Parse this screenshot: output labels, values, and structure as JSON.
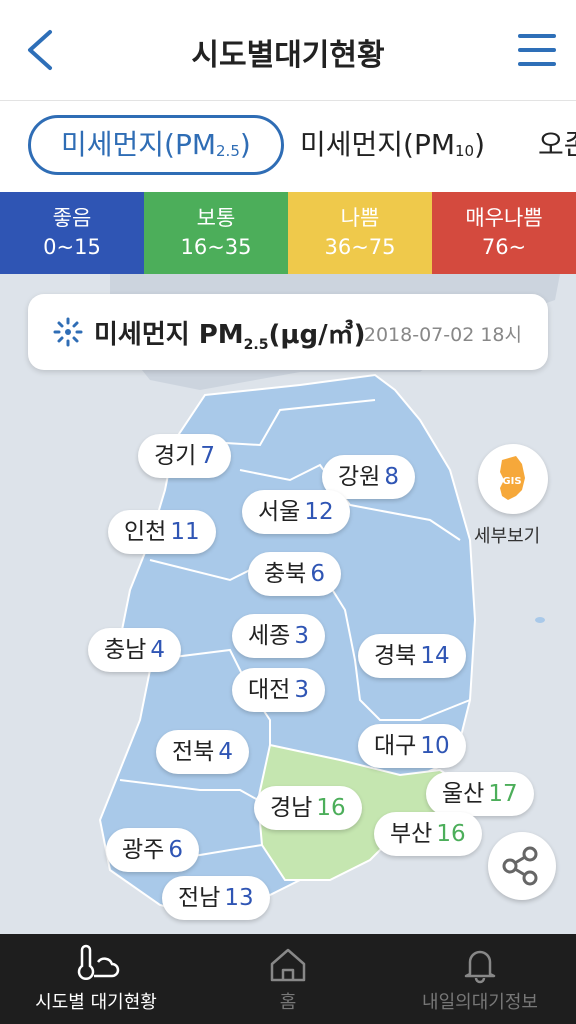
{
  "header": {
    "title": "시도별대기현황"
  },
  "tabs": [
    {
      "label": "미세먼지(PM",
      "sub": "2.5",
      "close": ")"
    },
    {
      "label": "미세먼지(PM",
      "sub": "10",
      "close": ")"
    },
    {
      "label": "오존"
    }
  ],
  "legend": [
    {
      "label": "좋음",
      "range": "0~15",
      "color": "#2f55b4"
    },
    {
      "label": "보통",
      "range": "16~35",
      "color": "#4cae5a"
    },
    {
      "label": "나쁨",
      "range": "36~75",
      "color": "#efc94b"
    },
    {
      "label": "매우나쁨",
      "range": "76~",
      "color": "#d44a3e"
    }
  ],
  "card": {
    "label": "미세먼지 PM",
    "sub": "2.5",
    "unit": "(μg/㎥)",
    "date": "2018-07-02 18시"
  },
  "regions": [
    {
      "name": "경기",
      "value": "7",
      "color": "#2f55b4"
    },
    {
      "name": "강원",
      "value": "8",
      "color": "#2f55b4"
    },
    {
      "name": "서울",
      "value": "12",
      "color": "#2f55b4"
    },
    {
      "name": "인천",
      "value": "11",
      "color": "#2f55b4"
    },
    {
      "name": "충북",
      "value": "6",
      "color": "#2f55b4"
    },
    {
      "name": "세종",
      "value": "3",
      "color": "#2f55b4"
    },
    {
      "name": "충남",
      "value": "4",
      "color": "#2f55b4"
    },
    {
      "name": "경북",
      "value": "14",
      "color": "#2f55b4"
    },
    {
      "name": "대전",
      "value": "3",
      "color": "#2f55b4"
    },
    {
      "name": "대구",
      "value": "10",
      "color": "#2f55b4"
    },
    {
      "name": "전북",
      "value": "4",
      "color": "#2f55b4"
    },
    {
      "name": "울산",
      "value": "17",
      "color": "#4cae5a"
    },
    {
      "name": "경남",
      "value": "16",
      "color": "#4cae5a"
    },
    {
      "name": "부산",
      "value": "16",
      "color": "#4cae5a"
    },
    {
      "name": "광주",
      "value": "6",
      "color": "#2f55b4"
    },
    {
      "name": "전남",
      "value": "13",
      "color": "#2f55b4"
    }
  ],
  "gis": {
    "badge": "GIS",
    "label": "세부보기"
  },
  "bottom_nav": [
    {
      "label": "시도별 대기현황"
    },
    {
      "label": "홈"
    },
    {
      "label": "내일의대기정보"
    }
  ]
}
